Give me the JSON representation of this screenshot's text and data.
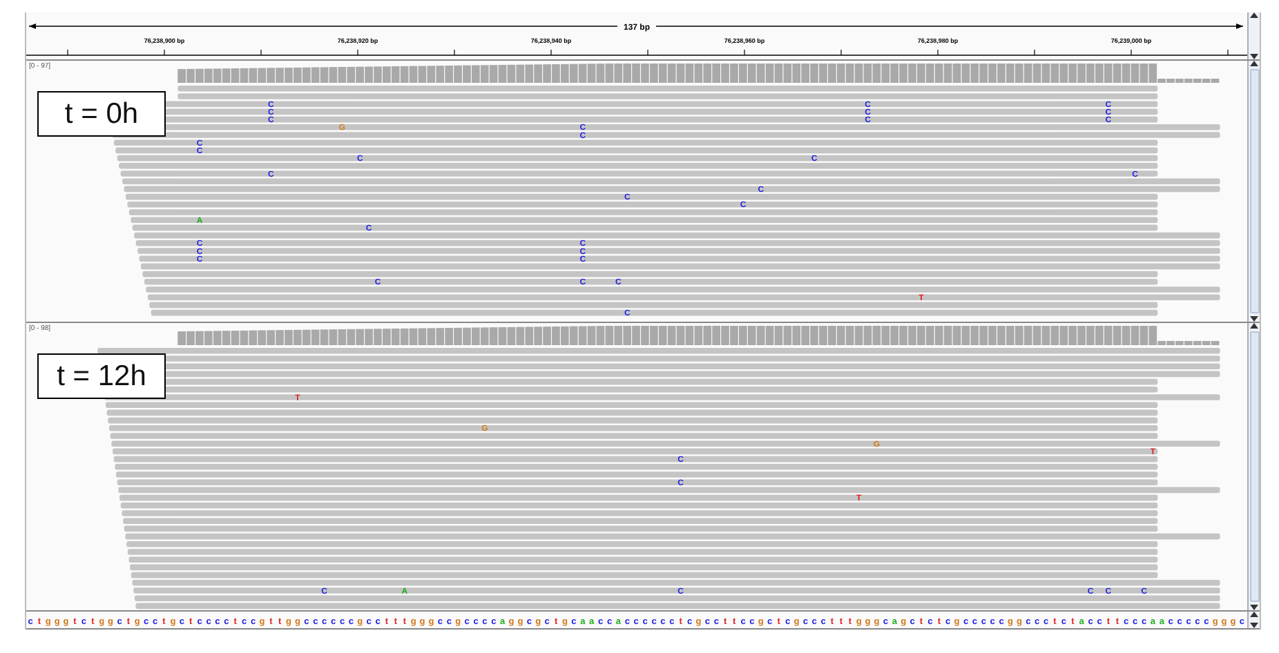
{
  "ruler": {
    "span": "137 bp",
    "ticks": [
      "76,238,900 bp",
      "76,238,920 bp",
      "76,238,940 bp",
      "76,238,960 bp",
      "76,238,980 bp",
      "76,239,000 bp"
    ]
  },
  "panels": [
    {
      "label": "t = 0h",
      "coverage_range": "[0 - 97]",
      "mismatches": [
        {
          "base": "C",
          "color": "#1f1fe0"
        },
        {
          "base": "C",
          "color": "#1f1fe0"
        },
        {
          "base": "C",
          "color": "#1f1fe0"
        },
        {
          "base": "C",
          "color": "#1f1fe0"
        },
        {
          "base": "C",
          "color": "#1f1fe0"
        },
        {
          "base": "C",
          "color": "#1f1fe0"
        },
        {
          "base": "C",
          "color": "#1f1fe0"
        },
        {
          "base": "C",
          "color": "#1f1fe0"
        },
        {
          "base": "C",
          "color": "#1f1fe0"
        },
        {
          "base": "G",
          "color": "#d1781a"
        },
        {
          "base": "C",
          "color": "#1f1fe0"
        },
        {
          "base": "C",
          "color": "#1f1fe0"
        },
        {
          "base": "C",
          "color": "#1f1fe0"
        },
        {
          "base": "C",
          "color": "#1f1fe0"
        },
        {
          "base": "C",
          "color": "#1f1fe0"
        },
        {
          "base": "C",
          "color": "#1f1fe0"
        },
        {
          "base": "C",
          "color": "#1f1fe0"
        },
        {
          "base": "C",
          "color": "#1f1fe0"
        },
        {
          "base": "C",
          "color": "#1f1fe0"
        },
        {
          "base": "C",
          "color": "#1f1fe0"
        },
        {
          "base": "C",
          "color": "#1f1fe0"
        },
        {
          "base": "A",
          "color": "#1fae1f"
        },
        {
          "base": "C",
          "color": "#1f1fe0"
        },
        {
          "base": "C",
          "color": "#1f1fe0"
        },
        {
          "base": "C",
          "color": "#1f1fe0"
        },
        {
          "base": "C",
          "color": "#1f1fe0"
        },
        {
          "base": "C",
          "color": "#1f1fe0"
        },
        {
          "base": "C",
          "color": "#1f1fe0"
        },
        {
          "base": "C",
          "color": "#1f1fe0"
        },
        {
          "base": "C",
          "color": "#1f1fe0"
        },
        {
          "base": "C",
          "color": "#1f1fe0"
        },
        {
          "base": "C",
          "color": "#1f1fe0"
        },
        {
          "base": "T",
          "color": "#e01f1f"
        },
        {
          "base": "C",
          "color": "#1f1fe0"
        }
      ]
    },
    {
      "label": "t = 12h",
      "coverage_range": "[0 - 98]",
      "mismatches": [
        {
          "base": "T",
          "color": "#e01f1f"
        },
        {
          "base": "G",
          "color": "#d1781a"
        },
        {
          "base": "G",
          "color": "#d1781a"
        },
        {
          "base": "T",
          "color": "#e01f1f"
        },
        {
          "base": "C",
          "color": "#1f1fe0"
        },
        {
          "base": "C",
          "color": "#1f1fe0"
        },
        {
          "base": "T",
          "color": "#e01f1f"
        },
        {
          "base": "C",
          "color": "#1f1fe0"
        },
        {
          "base": "A",
          "color": "#1fae1f"
        },
        {
          "base": "C",
          "color": "#1f1fe0"
        },
        {
          "base": "C",
          "color": "#1f1fe0"
        },
        {
          "base": "C",
          "color": "#1f1fe0"
        },
        {
          "base": "C",
          "color": "#1f1fe0"
        }
      ]
    }
  ],
  "sequence": [
    {
      "base": "c",
      "color": "#1f1fe0"
    },
    {
      "base": "t",
      "color": "#e01f1f"
    },
    {
      "base": "g",
      "color": "#d1781a"
    },
    {
      "base": "g",
      "color": "#d1781a"
    },
    {
      "base": "g",
      "color": "#d1781a"
    },
    {
      "base": "t",
      "color": "#e01f1f"
    },
    {
      "base": "c",
      "color": "#1f1fe0"
    },
    {
      "base": "t",
      "color": "#e01f1f"
    },
    {
      "base": "g",
      "color": "#d1781a"
    },
    {
      "base": "g",
      "color": "#d1781a"
    },
    {
      "base": "c",
      "color": "#1f1fe0"
    },
    {
      "base": "t",
      "color": "#e01f1f"
    },
    {
      "base": "g",
      "color": "#d1781a"
    },
    {
      "base": "c",
      "color": "#1f1fe0"
    },
    {
      "base": "c",
      "color": "#1f1fe0"
    },
    {
      "base": "t",
      "color": "#e01f1f"
    },
    {
      "base": "g",
      "color": "#d1781a"
    },
    {
      "base": "c",
      "color": "#1f1fe0"
    },
    {
      "base": "t",
      "color": "#e01f1f"
    },
    {
      "base": "c",
      "color": "#1f1fe0"
    },
    {
      "base": "c",
      "color": "#1f1fe0"
    },
    {
      "base": "c",
      "color": "#1f1fe0"
    },
    {
      "base": "c",
      "color": "#1f1fe0"
    },
    {
      "base": "t",
      "color": "#e01f1f"
    },
    {
      "base": "c",
      "color": "#1f1fe0"
    },
    {
      "base": "c",
      "color": "#1f1fe0"
    },
    {
      "base": "g",
      "color": "#d1781a"
    },
    {
      "base": "t",
      "color": "#e01f1f"
    },
    {
      "base": "t",
      "color": "#e01f1f"
    },
    {
      "base": "g",
      "color": "#d1781a"
    },
    {
      "base": "g",
      "color": "#d1781a"
    },
    {
      "base": "c",
      "color": "#1f1fe0"
    },
    {
      "base": "c",
      "color": "#1f1fe0"
    },
    {
      "base": "c",
      "color": "#1f1fe0"
    },
    {
      "base": "c",
      "color": "#1f1fe0"
    },
    {
      "base": "c",
      "color": "#1f1fe0"
    },
    {
      "base": "c",
      "color": "#1f1fe0"
    },
    {
      "base": "g",
      "color": "#d1781a"
    },
    {
      "base": "c",
      "color": "#1f1fe0"
    },
    {
      "base": "c",
      "color": "#1f1fe0"
    },
    {
      "base": "t",
      "color": "#e01f1f"
    },
    {
      "base": "t",
      "color": "#e01f1f"
    },
    {
      "base": "t",
      "color": "#e01f1f"
    },
    {
      "base": "g",
      "color": "#d1781a"
    },
    {
      "base": "g",
      "color": "#d1781a"
    },
    {
      "base": "g",
      "color": "#d1781a"
    },
    {
      "base": "c",
      "color": "#1f1fe0"
    },
    {
      "base": "c",
      "color": "#1f1fe0"
    },
    {
      "base": "g",
      "color": "#d1781a"
    },
    {
      "base": "c",
      "color": "#1f1fe0"
    },
    {
      "base": "c",
      "color": "#1f1fe0"
    },
    {
      "base": "c",
      "color": "#1f1fe0"
    },
    {
      "base": "c",
      "color": "#1f1fe0"
    },
    {
      "base": "a",
      "color": "#1fae1f"
    },
    {
      "base": "g",
      "color": "#d1781a"
    },
    {
      "base": "g",
      "color": "#d1781a"
    },
    {
      "base": "c",
      "color": "#1f1fe0"
    },
    {
      "base": "g",
      "color": "#d1781a"
    },
    {
      "base": "c",
      "color": "#1f1fe0"
    },
    {
      "base": "t",
      "color": "#e01f1f"
    },
    {
      "base": "g",
      "color": "#d1781a"
    },
    {
      "base": "c",
      "color": "#1f1fe0"
    },
    {
      "base": "a",
      "color": "#1fae1f"
    },
    {
      "base": "a",
      "color": "#1fae1f"
    },
    {
      "base": "c",
      "color": "#1f1fe0"
    },
    {
      "base": "c",
      "color": "#1f1fe0"
    },
    {
      "base": "a",
      "color": "#1fae1f"
    },
    {
      "base": "c",
      "color": "#1f1fe0"
    },
    {
      "base": "c",
      "color": "#1f1fe0"
    },
    {
      "base": "c",
      "color": "#1f1fe0"
    },
    {
      "base": "c",
      "color": "#1f1fe0"
    },
    {
      "base": "c",
      "color": "#1f1fe0"
    },
    {
      "base": "c",
      "color": "#1f1fe0"
    },
    {
      "base": "t",
      "color": "#e01f1f"
    },
    {
      "base": "c",
      "color": "#1f1fe0"
    },
    {
      "base": "g",
      "color": "#d1781a"
    },
    {
      "base": "c",
      "color": "#1f1fe0"
    },
    {
      "base": "c",
      "color": "#1f1fe0"
    },
    {
      "base": "t",
      "color": "#e01f1f"
    },
    {
      "base": "t",
      "color": "#e01f1f"
    },
    {
      "base": "c",
      "color": "#1f1fe0"
    },
    {
      "base": "c",
      "color": "#1f1fe0"
    },
    {
      "base": "g",
      "color": "#d1781a"
    },
    {
      "base": "c",
      "color": "#1f1fe0"
    },
    {
      "base": "t",
      "color": "#e01f1f"
    },
    {
      "base": "c",
      "color": "#1f1fe0"
    },
    {
      "base": "g",
      "color": "#d1781a"
    },
    {
      "base": "c",
      "color": "#1f1fe0"
    },
    {
      "base": "c",
      "color": "#1f1fe0"
    },
    {
      "base": "c",
      "color": "#1f1fe0"
    },
    {
      "base": "t",
      "color": "#e01f1f"
    },
    {
      "base": "t",
      "color": "#e01f1f"
    },
    {
      "base": "t",
      "color": "#e01f1f"
    },
    {
      "base": "g",
      "color": "#d1781a"
    },
    {
      "base": "g",
      "color": "#d1781a"
    },
    {
      "base": "g",
      "color": "#d1781a"
    },
    {
      "base": "c",
      "color": "#1f1fe0"
    },
    {
      "base": "a",
      "color": "#1fae1f"
    },
    {
      "base": "g",
      "color": "#d1781a"
    },
    {
      "base": "c",
      "color": "#1f1fe0"
    },
    {
      "base": "t",
      "color": "#e01f1f"
    },
    {
      "base": "c",
      "color": "#1f1fe0"
    },
    {
      "base": "t",
      "color": "#e01f1f"
    },
    {
      "base": "c",
      "color": "#1f1fe0"
    },
    {
      "base": "g",
      "color": "#d1781a"
    },
    {
      "base": "c",
      "color": "#1f1fe0"
    },
    {
      "base": "c",
      "color": "#1f1fe0"
    },
    {
      "base": "c",
      "color": "#1f1fe0"
    },
    {
      "base": "c",
      "color": "#1f1fe0"
    },
    {
      "base": "c",
      "color": "#1f1fe0"
    },
    {
      "base": "g",
      "color": "#d1781a"
    },
    {
      "base": "g",
      "color": "#d1781a"
    },
    {
      "base": "c",
      "color": "#1f1fe0"
    },
    {
      "base": "c",
      "color": "#1f1fe0"
    },
    {
      "base": "c",
      "color": "#1f1fe0"
    },
    {
      "base": "t",
      "color": "#e01f1f"
    },
    {
      "base": "c",
      "color": "#1f1fe0"
    },
    {
      "base": "t",
      "color": "#e01f1f"
    },
    {
      "base": "a",
      "color": "#1fae1f"
    },
    {
      "base": "c",
      "color": "#1f1fe0"
    },
    {
      "base": "c",
      "color": "#1f1fe0"
    },
    {
      "base": "t",
      "color": "#e01f1f"
    },
    {
      "base": "t",
      "color": "#e01f1f"
    },
    {
      "base": "c",
      "color": "#1f1fe0"
    },
    {
      "base": "c",
      "color": "#1f1fe0"
    },
    {
      "base": "c",
      "color": "#1f1fe0"
    },
    {
      "base": "a",
      "color": "#1fae1f"
    },
    {
      "base": "a",
      "color": "#1fae1f"
    },
    {
      "base": "c",
      "color": "#1f1fe0"
    },
    {
      "base": "c",
      "color": "#1f1fe0"
    },
    {
      "base": "c",
      "color": "#1f1fe0"
    },
    {
      "base": "c",
      "color": "#1f1fe0"
    },
    {
      "base": "c",
      "color": "#1f1fe0"
    },
    {
      "base": "g",
      "color": "#d1781a"
    },
    {
      "base": "g",
      "color": "#d1781a"
    },
    {
      "base": "g",
      "color": "#d1781a"
    },
    {
      "base": "c",
      "color": "#1f1fe0"
    }
  ]
}
